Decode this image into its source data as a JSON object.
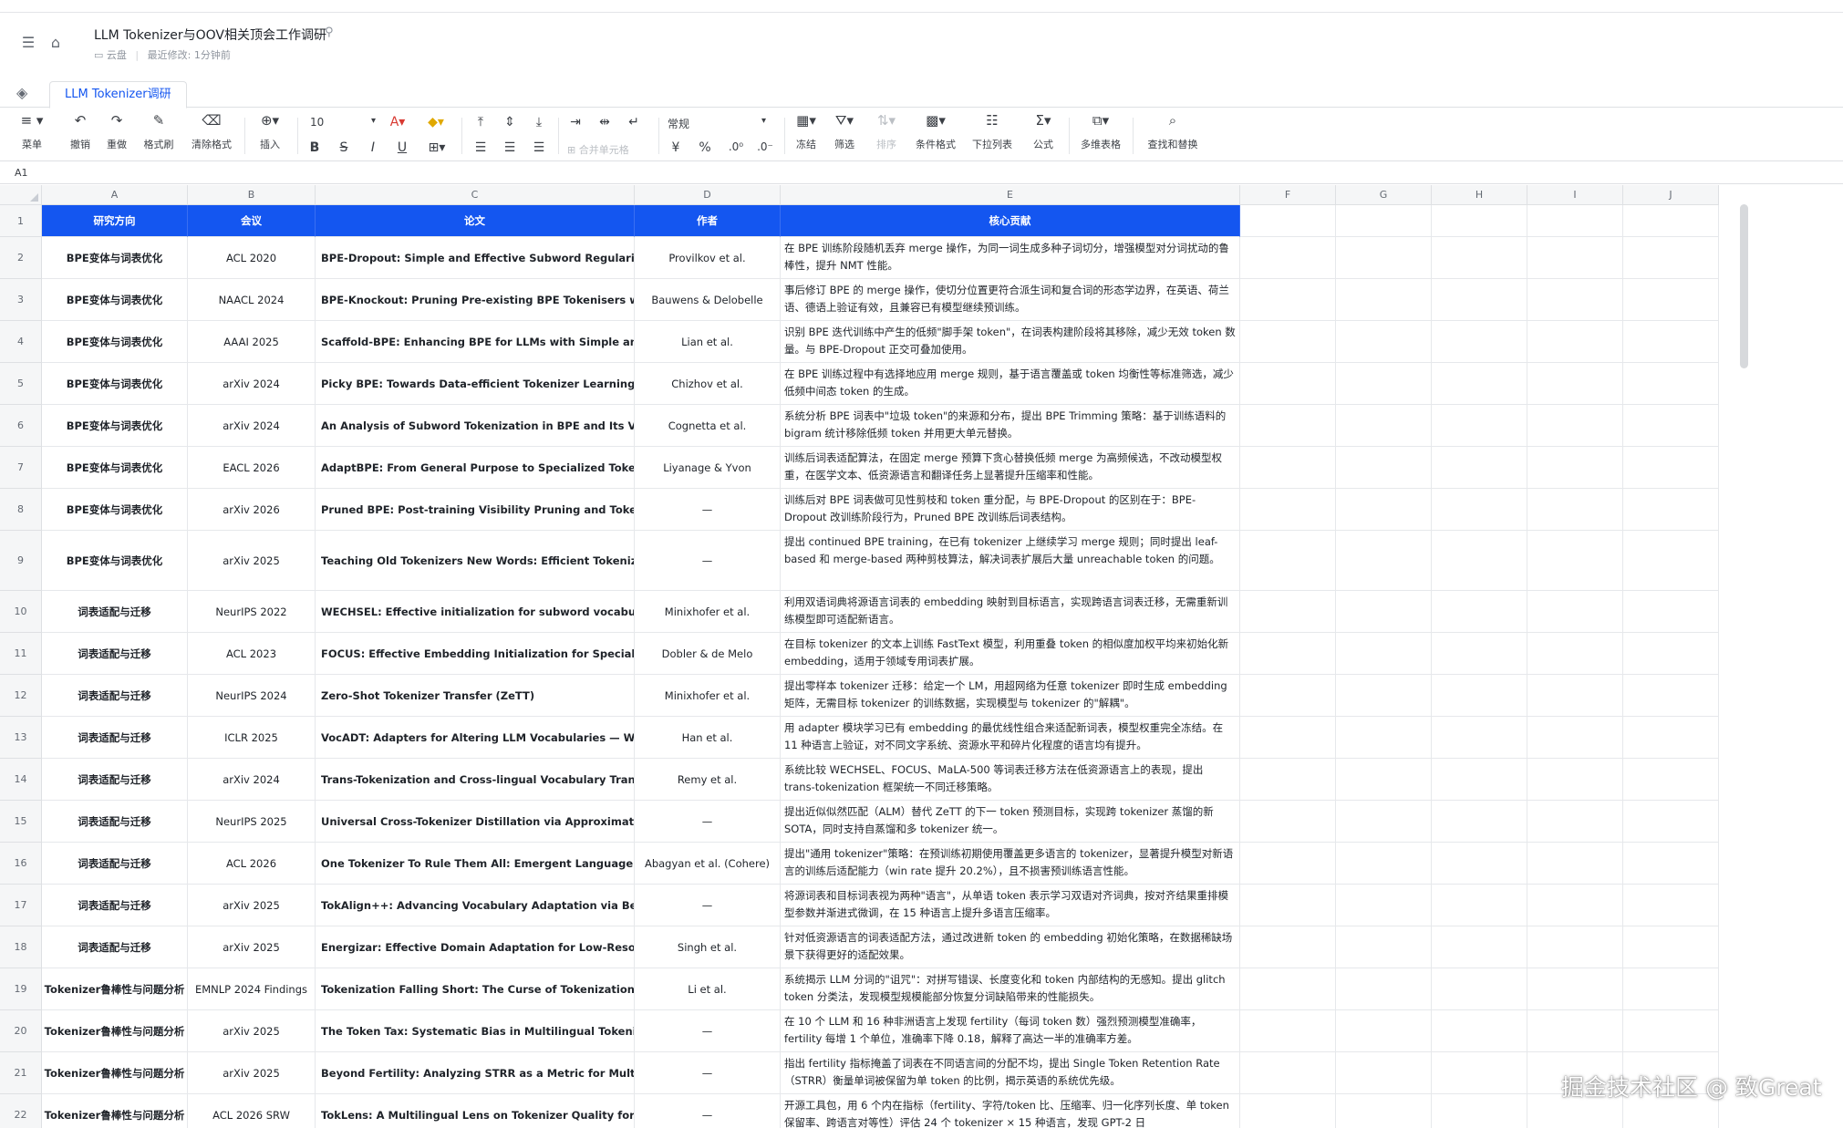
{
  "doc": {
    "title": "LLM Tokenizer与OOV相关顶会工作调研",
    "location": "云盘",
    "modified": "最近修改: 1分钟前"
  },
  "sheet_tab": "LLM Tokenizer调研",
  "toolbar": {
    "menu": "菜单",
    "undo": "撤销",
    "redo": "重做",
    "format_painter": "格式刷",
    "clear_format": "清除格式",
    "insert": "插入",
    "font_size": "10",
    "merge": "合并单元格",
    "number_format": "常规",
    "freeze": "冻结",
    "filter": "筛选",
    "sort": "排序",
    "cond_format": "条件格式",
    "dropdown": "下拉列表",
    "formula": "公式",
    "multi_table": "多维表格",
    "find_replace": "查找和替换"
  },
  "cell_ref": "A1",
  "columns": [
    "A",
    "B",
    "C",
    "D",
    "E",
    "F",
    "G",
    "H",
    "I",
    "J"
  ],
  "header_row": [
    "研究方向",
    "会议",
    "论文",
    "作者",
    "核心贡献"
  ],
  "rows": [
    {
      "n": "2",
      "a": "BPE变体与词表优化",
      "b": "ACL 2020",
      "c": "BPE-Dropout: Simple and Effective Subword Regularization",
      "d": "Provilkov et al.",
      "e": "在 BPE 训练阶段随机丢弃 merge 操作，为同一词生成多种子词切分，增强模型对分词扰动的鲁棒性，提升 NMT 性能。"
    },
    {
      "n": "3",
      "a": "BPE变体与词表优化",
      "b": "NAACL 2024",
      "c": "BPE-Knockout: Pruning Pre-existing BPE Tokenisers with Backwards-compatible Morphological Semi-supervision",
      "d": "Bauwens & Delobelle",
      "e": "事后修订 BPE 的 merge 操作，使切分位置更符合派生词和复合词的形态学边界，在英语、荷兰语、德语上验证有效，且兼容已有模型继续预训练。"
    },
    {
      "n": "4",
      "a": "BPE变体与词表优化",
      "b": "AAAI 2025",
      "c": "Scaffold-BPE: Enhancing BPE for LLMs with Simple and Effective Scaffold Token Removal",
      "d": "Lian et al.",
      "e": "识别 BPE 迭代训练中产生的低频\"脚手架 token\"，在词表构建阶段将其移除，减少无效 token 数量。与 BPE-Dropout 正交可叠加使用。"
    },
    {
      "n": "5",
      "a": "BPE变体与词表优化",
      "b": "arXiv 2024",
      "c": "Picky BPE: Towards Data-efficient Tokenizer Learning",
      "d": "Chizhov et al.",
      "e": "在 BPE 训练过程中有选择地应用 merge 规则，基于语言覆盖或 token 均衡性等标准筛选，减少低频中间态 token 的生成。"
    },
    {
      "n": "6",
      "a": "BPE变体与词表优化",
      "b": "arXiv 2024",
      "c": "An Analysis of Subword Tokenization in BPE and Its Variants",
      "d": "Cognetta et al.",
      "e": "系统分析 BPE 词表中\"垃圾 token\"的来源和分布，提出 BPE Trimming 策略：基于训练语料的 bigram 统计移除低频 token 并用更大单元替换。"
    },
    {
      "n": "7",
      "a": "BPE变体与词表优化",
      "b": "EACL 2026",
      "c": "AdaptBPE: From General Purpose to Specialized Tokenizers",
      "d": "Liyanage & Yvon",
      "e": "训练后词表适配算法，在固定 merge 预算下贪心替换低频 merge 为高频候选，不改动模型权重，在医学文本、低资源语言和翻译任务上显著提升压缩率和性能。"
    },
    {
      "n": "8",
      "a": "BPE变体与词表优化",
      "b": "arXiv 2026",
      "c": "Pruned BPE: Post-training Visibility Pruning and Token Reallocation",
      "d": "—",
      "e": "训练后对 BPE 词表做可见性剪枝和 token 重分配，与 BPE-Dropout 的区别在于：BPE-Dropout 改训练阶段行为，Pruned BPE 改训练后词表结构。"
    },
    {
      "n": "9",
      "a": "BPE变体与词表优化",
      "b": "arXiv 2025",
      "c": "Teaching Old Tokenizers New Words: Efficient Tokenizer Adaptation",
      "d": "—",
      "e": "提出 continued BPE training，在已有 tokenizer 上继续学习 merge 规则；同时提出 leaf-based 和 merge-based 两种剪枝算法，解决词表扩展后大量 unreachable token 的问题。"
    },
    {
      "n": "10",
      "a": "词表适配与迁移",
      "b": "NeurIPS 2022",
      "c": "WECHSEL: Effective initialization for subword vocabularies",
      "d": "Minixhofer et al.",
      "e": "利用双语词典将源语言词表的 embedding 映射到目标语言，实现跨语言词表迁移，无需重新训练模型即可适配新语言。"
    },
    {
      "n": "11",
      "a": "词表适配与迁移",
      "b": "ACL 2023",
      "c": "FOCUS: Effective Embedding Initialization for Specialized Tokenizers",
      "d": "Dobler & de Melo",
      "e": "在目标 tokenizer 的文本上训练 FastText 模型，利用重叠 token 的相似度加权平均来初始化新 embedding，适用于领域专用词表扩展。"
    },
    {
      "n": "12",
      "a": "词表适配与迁移",
      "b": "NeurIPS 2024",
      "c": "Zero-Shot Tokenizer Transfer (ZeTT)",
      "d": "Minixhofer et al.",
      "e": "提出零样本 tokenizer 迁移：给定一个 LM，用超网络为任意 tokenizer 即时生成 embedding 矩阵，无需目标 tokenizer 的训练数据，实现模型与 tokenizer 的\"解耦\"。"
    },
    {
      "n": "13",
      "a": "词表适配与迁移",
      "b": "ICLR 2025",
      "c": "VocADT: Adapters for Altering LLM Vocabularies — What Languages Benefit",
      "d": "Han et al.",
      "e": "用 adapter 模块学习已有 embedding 的最优线性组合来适配新词表，模型权重完全冻结。在 11 种语言上验证，对不同文字系统、资源水平和碎片化程度的语言均有提升。"
    },
    {
      "n": "14",
      "a": "词表适配与迁移",
      "b": "arXiv 2024",
      "c": "Trans-Tokenization and Cross-lingual Vocabulary Transfers",
      "d": "Remy et al.",
      "e": "系统比较 WECHSEL、FOCUS、MaLA-500 等词表迁移方法在低资源语言上的表现，提出 trans-tokenization 框架统一不同迁移策略。"
    },
    {
      "n": "15",
      "a": "词表适配与迁移",
      "b": "NeurIPS 2025",
      "c": "Universal Cross-Tokenizer Distillation via Approximate Likelihood Matching",
      "d": "—",
      "e": "提出近似似然匹配（ALM）替代 ZeTT 的下一 token 预测目标，实现跨 tokenizer 蒸馏的新 SOTA，同时支持自蒸馏和多 tokenizer 统一。"
    },
    {
      "n": "16",
      "a": "词表适配与迁移",
      "b": "ACL 2026",
      "c": "One Tokenizer To Rule Them All: Emergent Language Plasticity",
      "d": "Abagyan et al. (Cohere)",
      "e": "提出\"通用 tokenizer\"策略：在预训练初期使用覆盖更多语言的 tokenizer，显著提升模型对新语言的训练后适配能力（win rate 提升 20.2%），且不损害预训练语言性能。"
    },
    {
      "n": "17",
      "a": "词表适配与迁移",
      "b": "arXiv 2025",
      "c": "TokAlign++: Advancing Vocabulary Adaptation via Better Token Alignment",
      "d": "—",
      "e": "将源词表和目标词表视为两种\"语言\"，从单语 token 表示学习双语对齐词典，按对齐结果重排模型参数并渐进式微调，在 15 种语言上提升多语言压缩率。"
    },
    {
      "n": "18",
      "a": "词表适配与迁移",
      "b": "arXiv 2025",
      "c": "Energizar: Effective Domain Adaptation for Low-Resource Tokenizers",
      "d": "Singh et al.",
      "e": "针对低资源语言的词表适配方法，通过改进新 token 的 embedding 初始化策略，在数据稀缺场景下获得更好的适配效果。"
    },
    {
      "n": "19",
      "a": "Tokenizer鲁棒性与问题分析",
      "b": "EMNLP 2024 Findings",
      "c": "Tokenization Falling Short: The Curse of Tokenization",
      "d": "Li et al.",
      "e": "系统揭示 LLM 分词的\"诅咒\"：对拼写错误、长度变化和 token 内部结构的无感知。提出 glitch token 分类法，发现模型规模能部分恢复分词缺陷带来的性能损失。"
    },
    {
      "n": "20",
      "a": "Tokenizer鲁棒性与问题分析",
      "b": "arXiv 2025",
      "c": "The Token Tax: Systematic Bias in Multilingual Tokenization",
      "d": "—",
      "e": "在 10 个 LLM 和 16 种非洲语言上发现 fertility（每词 token 数）强烈预测模型准确率，fertility 每增 1 个单位，准确率下降 0.18，解释了高达一半的准确率方差。"
    },
    {
      "n": "21",
      "a": "Tokenizer鲁棒性与问题分析",
      "b": "arXiv 2025",
      "c": "Beyond Fertility: Analyzing STRR as a Metric for Multilingual Tokenization",
      "d": "—",
      "e": "指出 fertility 指标掩盖了词表在不同语言间的分配不均，提出 Single Token Retention Rate（STRR）衡量单词被保留为单 token 的比例，揭示英语的系统优先级。"
    },
    {
      "n": "22",
      "a": "Tokenizer鲁棒性与问题分析",
      "b": "ACL 2026 SRW",
      "c": "TokLens: A Multilingual Lens on Tokenizer Quality for LLMs",
      "d": "—",
      "e": "开源工具包，用 6 个内在指标（fertility、字符/token 比、压缩率、归一化序列长度、单 token 保留率、跨语言对等性）评估 24 个 tokenizer × 15 种语言，发现 GPT-2 日"
    }
  ],
  "watermark": "掘金技术社区 @ 致Great"
}
